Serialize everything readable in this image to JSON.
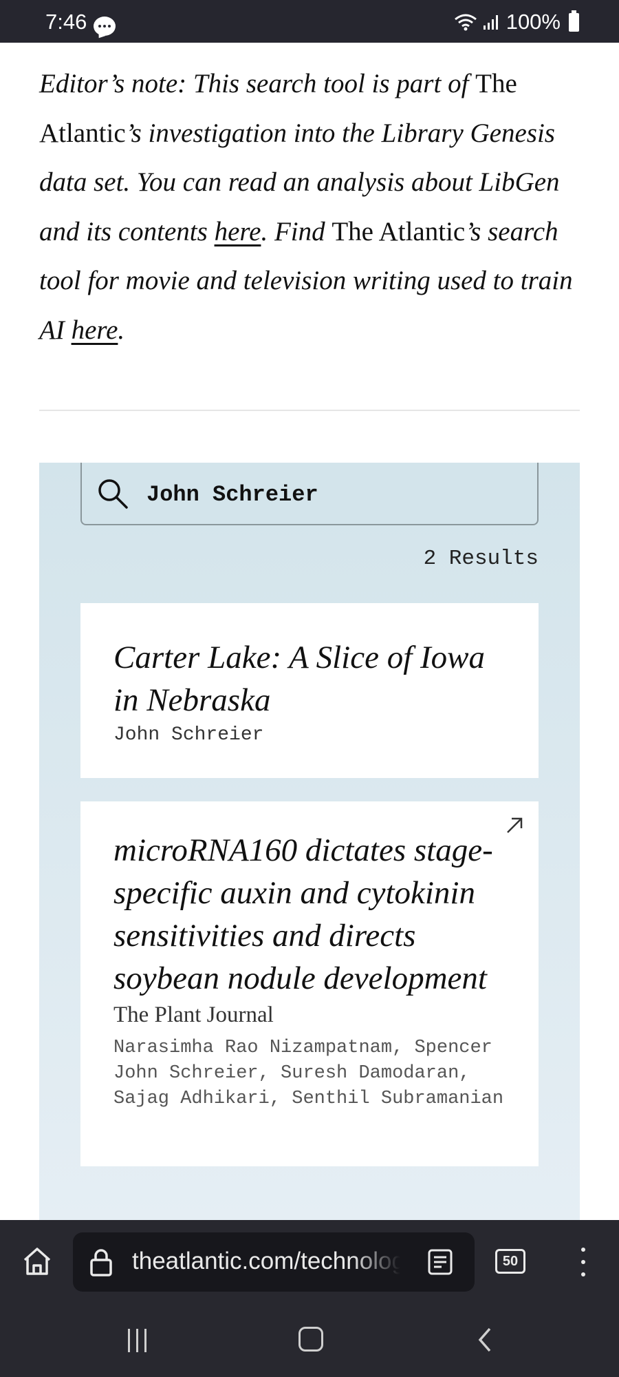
{
  "status_bar": {
    "time": "7:46",
    "battery": "100%"
  },
  "editor_note": {
    "parts": [
      {
        "text": "Editor’s note: This search tool is part of ",
        "style": "italic"
      },
      {
        "text": "The Atlantic",
        "style": "roman"
      },
      {
        "text": "’s investigation into the Library Genesis data set. You can read an analysis about LibGen and its contents ",
        "style": "italic"
      },
      {
        "text": "here",
        "style": "link"
      },
      {
        "text": ". Find ",
        "style": "italic"
      },
      {
        "text": "The Atlantic",
        "style": "roman"
      },
      {
        "text": "’s search tool for movie and television writing used to train AI ",
        "style": "italic"
      },
      {
        "text": "here",
        "style": "link"
      },
      {
        "text": ".",
        "style": "italic"
      }
    ]
  },
  "search": {
    "query": "John Schreier",
    "results_label": "2 Results"
  },
  "results": [
    {
      "title": "Carter Lake: A Slice of Iowa in Nebraska",
      "author": "John Schreier"
    },
    {
      "title": "microRNA160 dictates stage-specific auxin and cytokinin sensitivities and directs soybean nodule development",
      "journal": "The Plant Journal",
      "authors": "Narasimha Rao Nizampatnam, Spencer John Schreier, Suresh Damodaran, Sajag Adhikari, Senthil Subramanian"
    }
  ],
  "browser": {
    "url": "theatlantic.com/technology",
    "tab_count": "50"
  },
  "icons": {
    "search": "search-icon",
    "external": "external-link-icon",
    "home": "home-icon",
    "lock": "lock-icon",
    "reader": "reader-mode-icon",
    "menu": "more-vert-icon"
  },
  "colors": {
    "panel_top": "#d3e4eb",
    "panel_bottom": "#e5eef4",
    "bar": "#28282f"
  }
}
